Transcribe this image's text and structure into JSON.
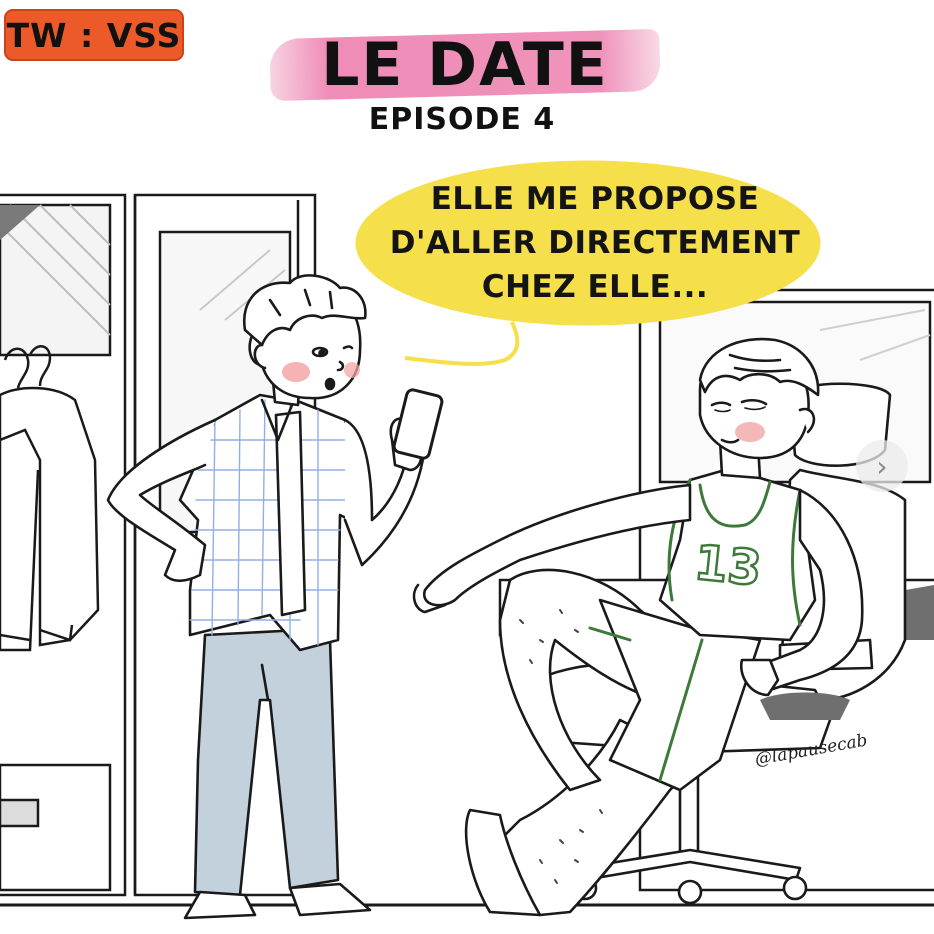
{
  "badge": {
    "label": "TW : VSS"
  },
  "header": {
    "title": "LE DATE",
    "episode": "EPISODE 4"
  },
  "speech_bubble": {
    "lines": [
      "ELLE ME PROPOSE",
      "D'ALLER DIRECTEMENT",
      "CHEZ ELLE..."
    ]
  },
  "characters": {
    "standing": {
      "description_icon": "person-holding-phone-icon"
    },
    "seated": {
      "jersey_number": "13"
    }
  },
  "credit": {
    "handle": "@lapausecab"
  },
  "controls": {
    "next_icon": "chevron-right-icon",
    "next_glyph": "›"
  },
  "colors": {
    "badge": "#ec5a2a",
    "title_brush": "#ec78aa",
    "bubble": "#f5df4a",
    "jeans": "#c2d1dc",
    "shirt_grid": "#8fb0e4",
    "blush": "#f3a6a6",
    "jersey_green": "#3d7a3a"
  }
}
